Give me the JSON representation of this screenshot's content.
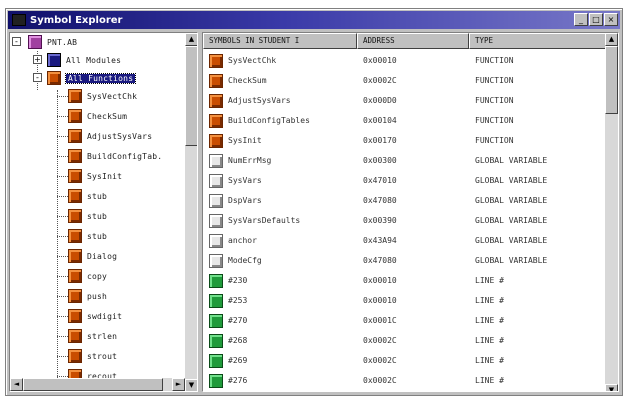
{
  "window": {
    "title": "Symbol Explorer"
  },
  "titlebar_buttons": [
    {
      "name": "minimize-button",
      "glyph": "_"
    },
    {
      "name": "maximize-button",
      "glyph": "□"
    },
    {
      "name": "close-button",
      "glyph": "×"
    }
  ],
  "tree": {
    "root": {
      "label": "PNT.AB",
      "expander": "-"
    },
    "modules": {
      "label": "All Modules",
      "expander": "+"
    },
    "functions": {
      "label": "All Functions",
      "expander": "-"
    },
    "function_items": [
      "SysVectChk",
      "CheckSum",
      "AdjustSysVars",
      "BuildConfigTab.",
      "SysInit",
      "stub",
      "stub",
      "stub",
      "Dialog",
      "copy",
      "push",
      "swdigit",
      "strlen",
      "strout",
      "recout"
    ]
  },
  "list": {
    "columns": [
      "SYMBOLS IN STUDENT I",
      "ADDRESS",
      "TYPE"
    ],
    "rows": [
      {
        "icon": "fn",
        "icon_label": "F",
        "name": "SysVectChk",
        "address": "0x00010",
        "type": "FUNCTION"
      },
      {
        "icon": "fn",
        "icon_label": "F",
        "name": "CheckSum",
        "address": "0x0002C",
        "type": "FUNCTION"
      },
      {
        "icon": "fn",
        "icon_label": "F",
        "name": "AdjustSysVars",
        "address": "0x000D0",
        "type": "FUNCTION"
      },
      {
        "icon": "fn",
        "icon_label": "F",
        "name": "BuildConfigTables",
        "address": "0x00104",
        "type": "FUNCTION"
      },
      {
        "icon": "fn",
        "icon_label": "F",
        "name": "SysInit",
        "address": "0x00170",
        "type": "FUNCTION"
      },
      {
        "icon": "var",
        "icon_label": "V",
        "name": "NumErrMsg",
        "address": "0x00300",
        "type": "GLOBAL VARIABLE"
      },
      {
        "icon": "var",
        "icon_label": "V",
        "name": "SysVars",
        "address": "0x47010",
        "type": "GLOBAL VARIABLE"
      },
      {
        "icon": "var",
        "icon_label": "V",
        "name": "DspVars",
        "address": "0x47080",
        "type": "GLOBAL VARIABLE"
      },
      {
        "icon": "var",
        "icon_label": "V",
        "name": "SysVarsDefaults",
        "address": "0x00390",
        "type": "GLOBAL VARIABLE"
      },
      {
        "icon": "var",
        "icon_label": "V",
        "name": "anchor",
        "address": "0x43A94",
        "type": "GLOBAL VARIABLE"
      },
      {
        "icon": "var",
        "icon_label": "V",
        "name": "ModeCfg",
        "address": "0x47080",
        "type": "GLOBAL VARIABLE"
      },
      {
        "icon": "line",
        "icon_label": "L",
        "name": "#230",
        "address": "0x00010",
        "type": "LINE #"
      },
      {
        "icon": "line",
        "icon_label": "L",
        "name": "#253",
        "address": "0x00010",
        "type": "LINE #"
      },
      {
        "icon": "line",
        "icon_label": "L",
        "name": "#270",
        "address": "0x0001C",
        "type": "LINE #"
      },
      {
        "icon": "line",
        "icon_label": "L",
        "name": "#268",
        "address": "0x0002C",
        "type": "LINE #"
      },
      {
        "icon": "line",
        "icon_label": "L",
        "name": "#269",
        "address": "0x0002C",
        "type": "LINE #"
      },
      {
        "icon": "line",
        "icon_label": "L",
        "name": "#276",
        "address": "0x0002C",
        "type": "LINE #"
      }
    ]
  },
  "scroll_arrows": {
    "up": "▲",
    "down": "▼",
    "left": "◄",
    "right": "►"
  },
  "colors": {
    "title_gradient_start": "#10106a",
    "function_icon": "#c94d00",
    "variable_icon": "#e8e8e8",
    "line_icon": "#1f9a3a",
    "selection": "#1a1a80"
  }
}
